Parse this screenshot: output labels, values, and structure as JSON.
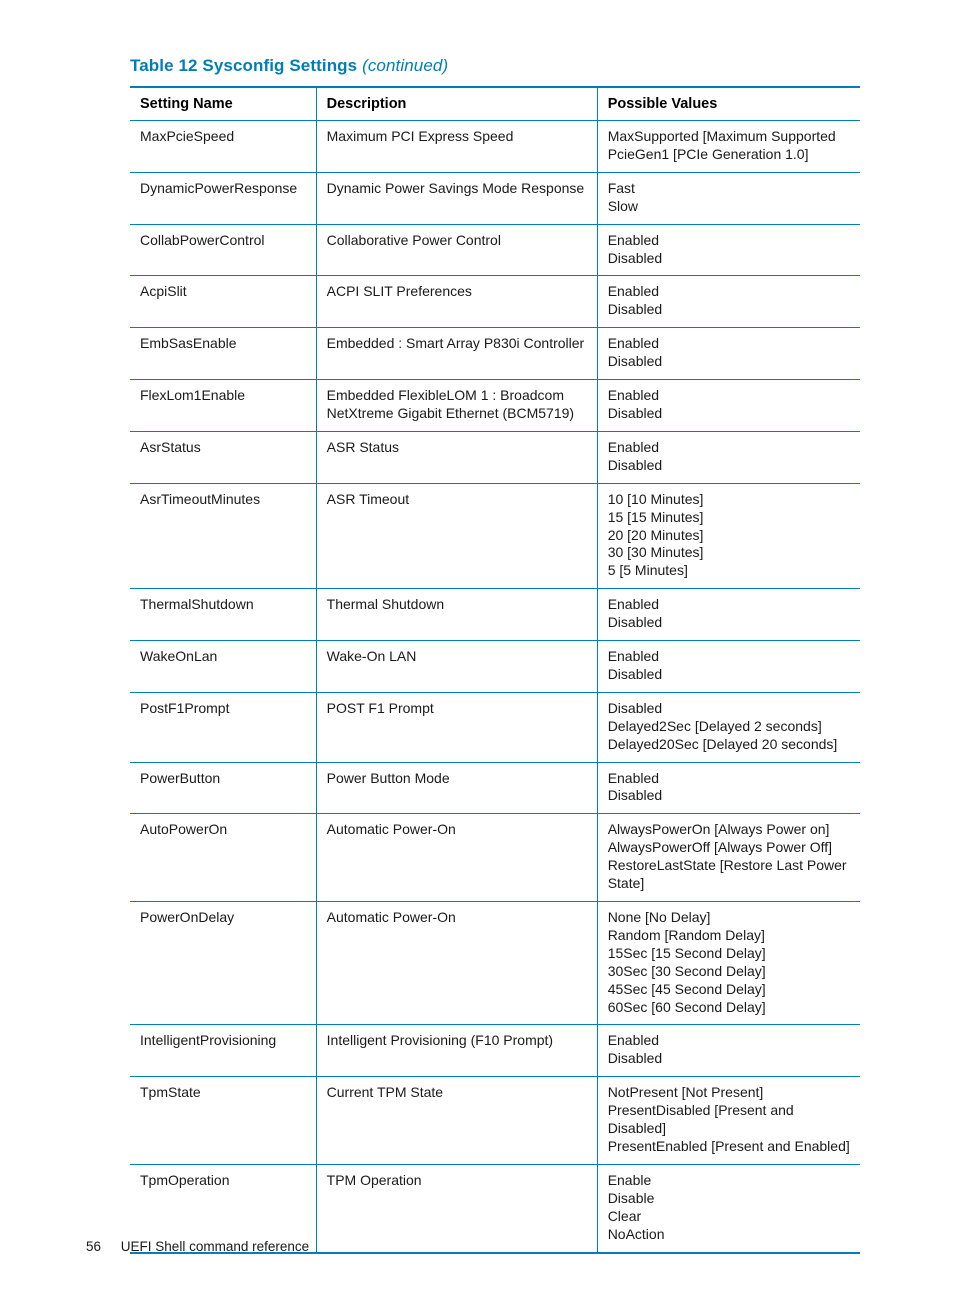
{
  "title": {
    "main": "Table 12 Sysconfig Settings",
    "continued": "(continued)"
  },
  "columns": {
    "name": "Setting Name",
    "desc": "Description",
    "vals": "Possible Values"
  },
  "rows": [
    {
      "name": "MaxPcieSpeed",
      "desc": "Maximum PCI Express Speed",
      "vals": [
        "MaxSupported [Maximum Supported",
        "PcieGen1 [PCIe Generation 1.0]"
      ]
    },
    {
      "name": "DynamicPowerResponse",
      "desc": "Dynamic Power Savings Mode Response",
      "vals": [
        "Fast",
        "Slow"
      ]
    },
    {
      "name": "CollabPowerControl",
      "desc": "Collaborative Power Control",
      "vals": [
        "Enabled",
        "Disabled"
      ]
    },
    {
      "name": "AcpiSlit",
      "desc": "ACPI SLIT Preferences",
      "vals": [
        "Enabled",
        "Disabled"
      ]
    },
    {
      "name": "EmbSasEnable",
      "desc": "Embedded : Smart Array P830i Controller",
      "vals": [
        "Enabled",
        "Disabled"
      ]
    },
    {
      "name": "FlexLom1Enable",
      "desc": "Embedded FlexibleLOM 1 : Broadcom NetXtreme Gigabit Ethernet (BCM5719)",
      "vals": [
        "Enabled",
        "Disabled"
      ]
    },
    {
      "name": "AsrStatus",
      "desc": "ASR Status",
      "vals": [
        "Enabled",
        "Disabled"
      ]
    },
    {
      "name": "AsrTimeoutMinutes",
      "desc": "ASR Timeout",
      "vals": [
        "10 [10 Minutes]",
        "15 [15 Minutes]",
        "20 [20 Minutes]",
        "30 [30 Minutes]",
        "5 [5 Minutes]"
      ]
    },
    {
      "name": "ThermalShutdown",
      "desc": "Thermal Shutdown",
      "vals": [
        "Enabled",
        "Disabled"
      ]
    },
    {
      "name": "WakeOnLan",
      "desc": "Wake-On LAN",
      "vals": [
        "Enabled",
        "Disabled"
      ]
    },
    {
      "name": "PostF1Prompt",
      "desc": "POST F1 Prompt",
      "vals": [
        "Disabled",
        "Delayed2Sec [Delayed 2 seconds]",
        "Delayed20Sec [Delayed 20 seconds]"
      ]
    },
    {
      "name": "PowerButton",
      "desc": "Power Button Mode",
      "vals": [
        "Enabled",
        "Disabled"
      ]
    },
    {
      "name": "AutoPowerOn",
      "desc": "Automatic Power-On",
      "vals": [
        "AlwaysPowerOn [Always Power on]",
        "AlwaysPowerOff [Always Power Off]",
        "RestoreLastState [Restore Last Power State]"
      ]
    },
    {
      "name": "PowerOnDelay",
      "desc": "Automatic Power-On",
      "vals": [
        "None [No Delay]",
        "Random [Random Delay]",
        "15Sec [15 Second Delay]",
        "30Sec [30 Second Delay]",
        "45Sec [45 Second Delay]",
        "60Sec [60 Second Delay]"
      ]
    },
    {
      "name": "IntelligentProvisioning",
      "desc": "Intelligent Provisioning (F10 Prompt)",
      "vals": [
        "Enabled",
        "Disabled"
      ]
    },
    {
      "name": "TpmState",
      "desc": "Current TPM State",
      "vals": [
        "NotPresent [Not Present]",
        "PresentDisabled [Present and Disabled]",
        "PresentEnabled [Present and Enabled]"
      ]
    },
    {
      "name": "TpmOperation",
      "desc": "TPM Operation",
      "vals": [
        "Enable",
        "Disable",
        "Clear",
        "NoAction"
      ]
    }
  ],
  "footer": {
    "page": "56",
    "section": "UEFI Shell command reference"
  }
}
